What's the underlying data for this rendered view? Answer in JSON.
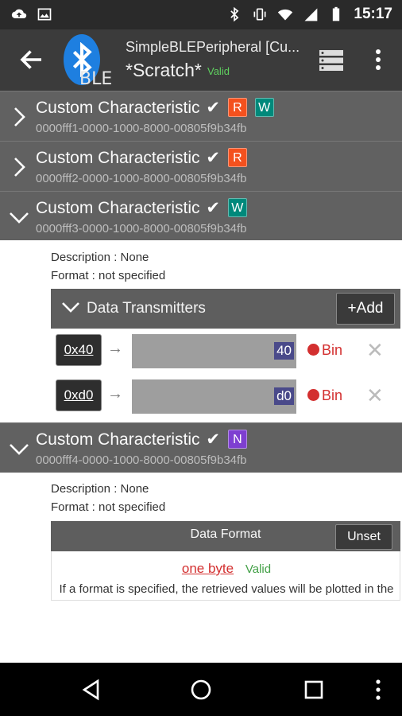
{
  "status_bar": {
    "time": "15:17",
    "icons_left": [
      "cloud-upload-icon",
      "image-icon"
    ],
    "icons_right": [
      "bluetooth-icon",
      "vibrate-icon",
      "wifi-icon",
      "signal-icon",
      "battery-icon"
    ]
  },
  "app_bar": {
    "title": "SimpleBLEPeripheral [Cu...",
    "subtitle": "*Scratch*",
    "valid": "Valid",
    "logo_text": "BLE"
  },
  "characteristics": [
    {
      "name": "Custom Characteristic",
      "check": "✔",
      "uuid": "0000fff1-0000-1000-8000-00805f9b34fb",
      "badges": [
        "R",
        "W"
      ],
      "expanded": false
    },
    {
      "name": "Custom Characteristic",
      "check": "✔",
      "uuid": "0000fff2-0000-1000-8000-00805f9b34fb",
      "badges": [
        "R"
      ],
      "expanded": false
    },
    {
      "name": "Custom Characteristic",
      "check": "✔",
      "uuid": "0000fff3-0000-1000-8000-00805f9b34fb",
      "badges": [
        "W"
      ],
      "expanded": true
    },
    {
      "name": "Custom Characteristic",
      "check": "✔",
      "uuid": "0000fff4-0000-1000-8000-00805f9b34fb",
      "badges": [
        "N"
      ],
      "expanded": true
    }
  ],
  "fff3_details": {
    "description": "Description : None",
    "format": "Format : not specified",
    "transmitters_label": "Data Transmitters",
    "add_label": "+Add",
    "rows": [
      {
        "hex": "0x40",
        "arrow": "→",
        "value": "40",
        "bin": "Bin",
        "remove": "✕"
      },
      {
        "hex": "0xd0",
        "arrow": "→",
        "value": "d0",
        "bin": "Bin",
        "remove": "✕"
      }
    ]
  },
  "fff4_details": {
    "description": "Description : None",
    "format": "Format : not specified",
    "data_format_label": "Data Format",
    "unset_label": "Unset",
    "format_value": "one byte",
    "format_valid": "Valid",
    "hint": "If a format is specified, the retrieved values will be plotted in the graph plane."
  },
  "nav_bar": {
    "icons": [
      "back-triangle-icon",
      "home-circle-icon",
      "recents-square-icon",
      "more-vert-icon"
    ]
  },
  "colors": {
    "header_bg": "#616161",
    "read_badge": "#f4511e",
    "write_badge": "#00897b",
    "notify_badge": "#7e3fd1",
    "bluetooth": "#1e7fe0"
  }
}
